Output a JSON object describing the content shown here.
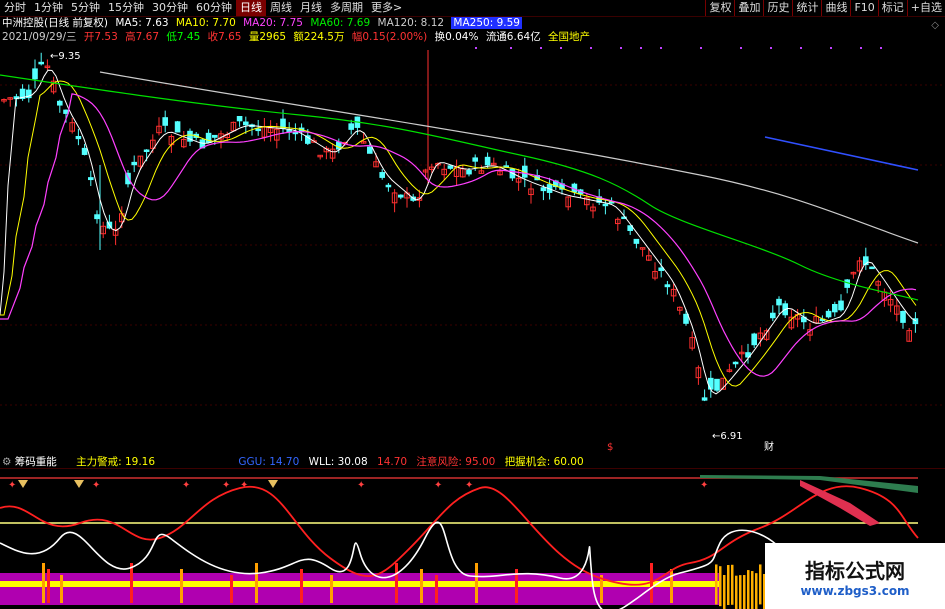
{
  "toolbar": {
    "periods": [
      "分时",
      "1分钟",
      "5分钟",
      "15分钟",
      "30分钟",
      "60分钟",
      "日线",
      "周线",
      "月线",
      "多周期",
      "更多>"
    ],
    "active_period": "日线",
    "buttons": [
      "复权",
      "叠加",
      "历史",
      "统计",
      "曲线",
      "F10",
      "标记",
      "+自选"
    ]
  },
  "stock": {
    "name": "中洲控股(日线 前复权)",
    "ma5": "MA5: 7.63",
    "ma10": "MA10: 7.70",
    "ma20": "MA20: 7.75",
    "ma60": "MA60: 7.69",
    "ma120": "MA120: 8.12",
    "ma250": "MA250: 9.59"
  },
  "quote": {
    "date": "2021/09/29/三",
    "open": "开7.53",
    "high": "高7.67",
    "low": "低7.45",
    "close": "收7.65",
    "volume": "量2965",
    "amount": "额224.5万",
    "change": "幅0.15(2.00%)",
    "turnover": "换0.04%",
    "float": "流通6.64亿",
    "sector": "全国地产"
  },
  "chart_data": {
    "type": "candlestick",
    "price_high_label": "9.35",
    "price_low_label": "6.91",
    "markers": [
      "$",
      "财"
    ],
    "indicator": {
      "name": "筹码重能",
      "zhuli": "主力警戒: 19.16",
      "ggu": "GGU: 14.70",
      "wll": "WLL: 30.08",
      "v14": "14.70",
      "risk": "注意风险: 95.00",
      "chance": "把握机会: 60.00"
    }
  },
  "colors": {
    "up": "#ff3030",
    "down": "#54ffff",
    "ma5": "#ffffff",
    "ma10": "#ffff00",
    "ma20": "#ff40ff",
    "ma60": "#00e000",
    "ma120": "#cccccc",
    "ma250": "#3050ff"
  },
  "logo": {
    "title": "指标公式网",
    "url": "www.zbgs3.com"
  }
}
